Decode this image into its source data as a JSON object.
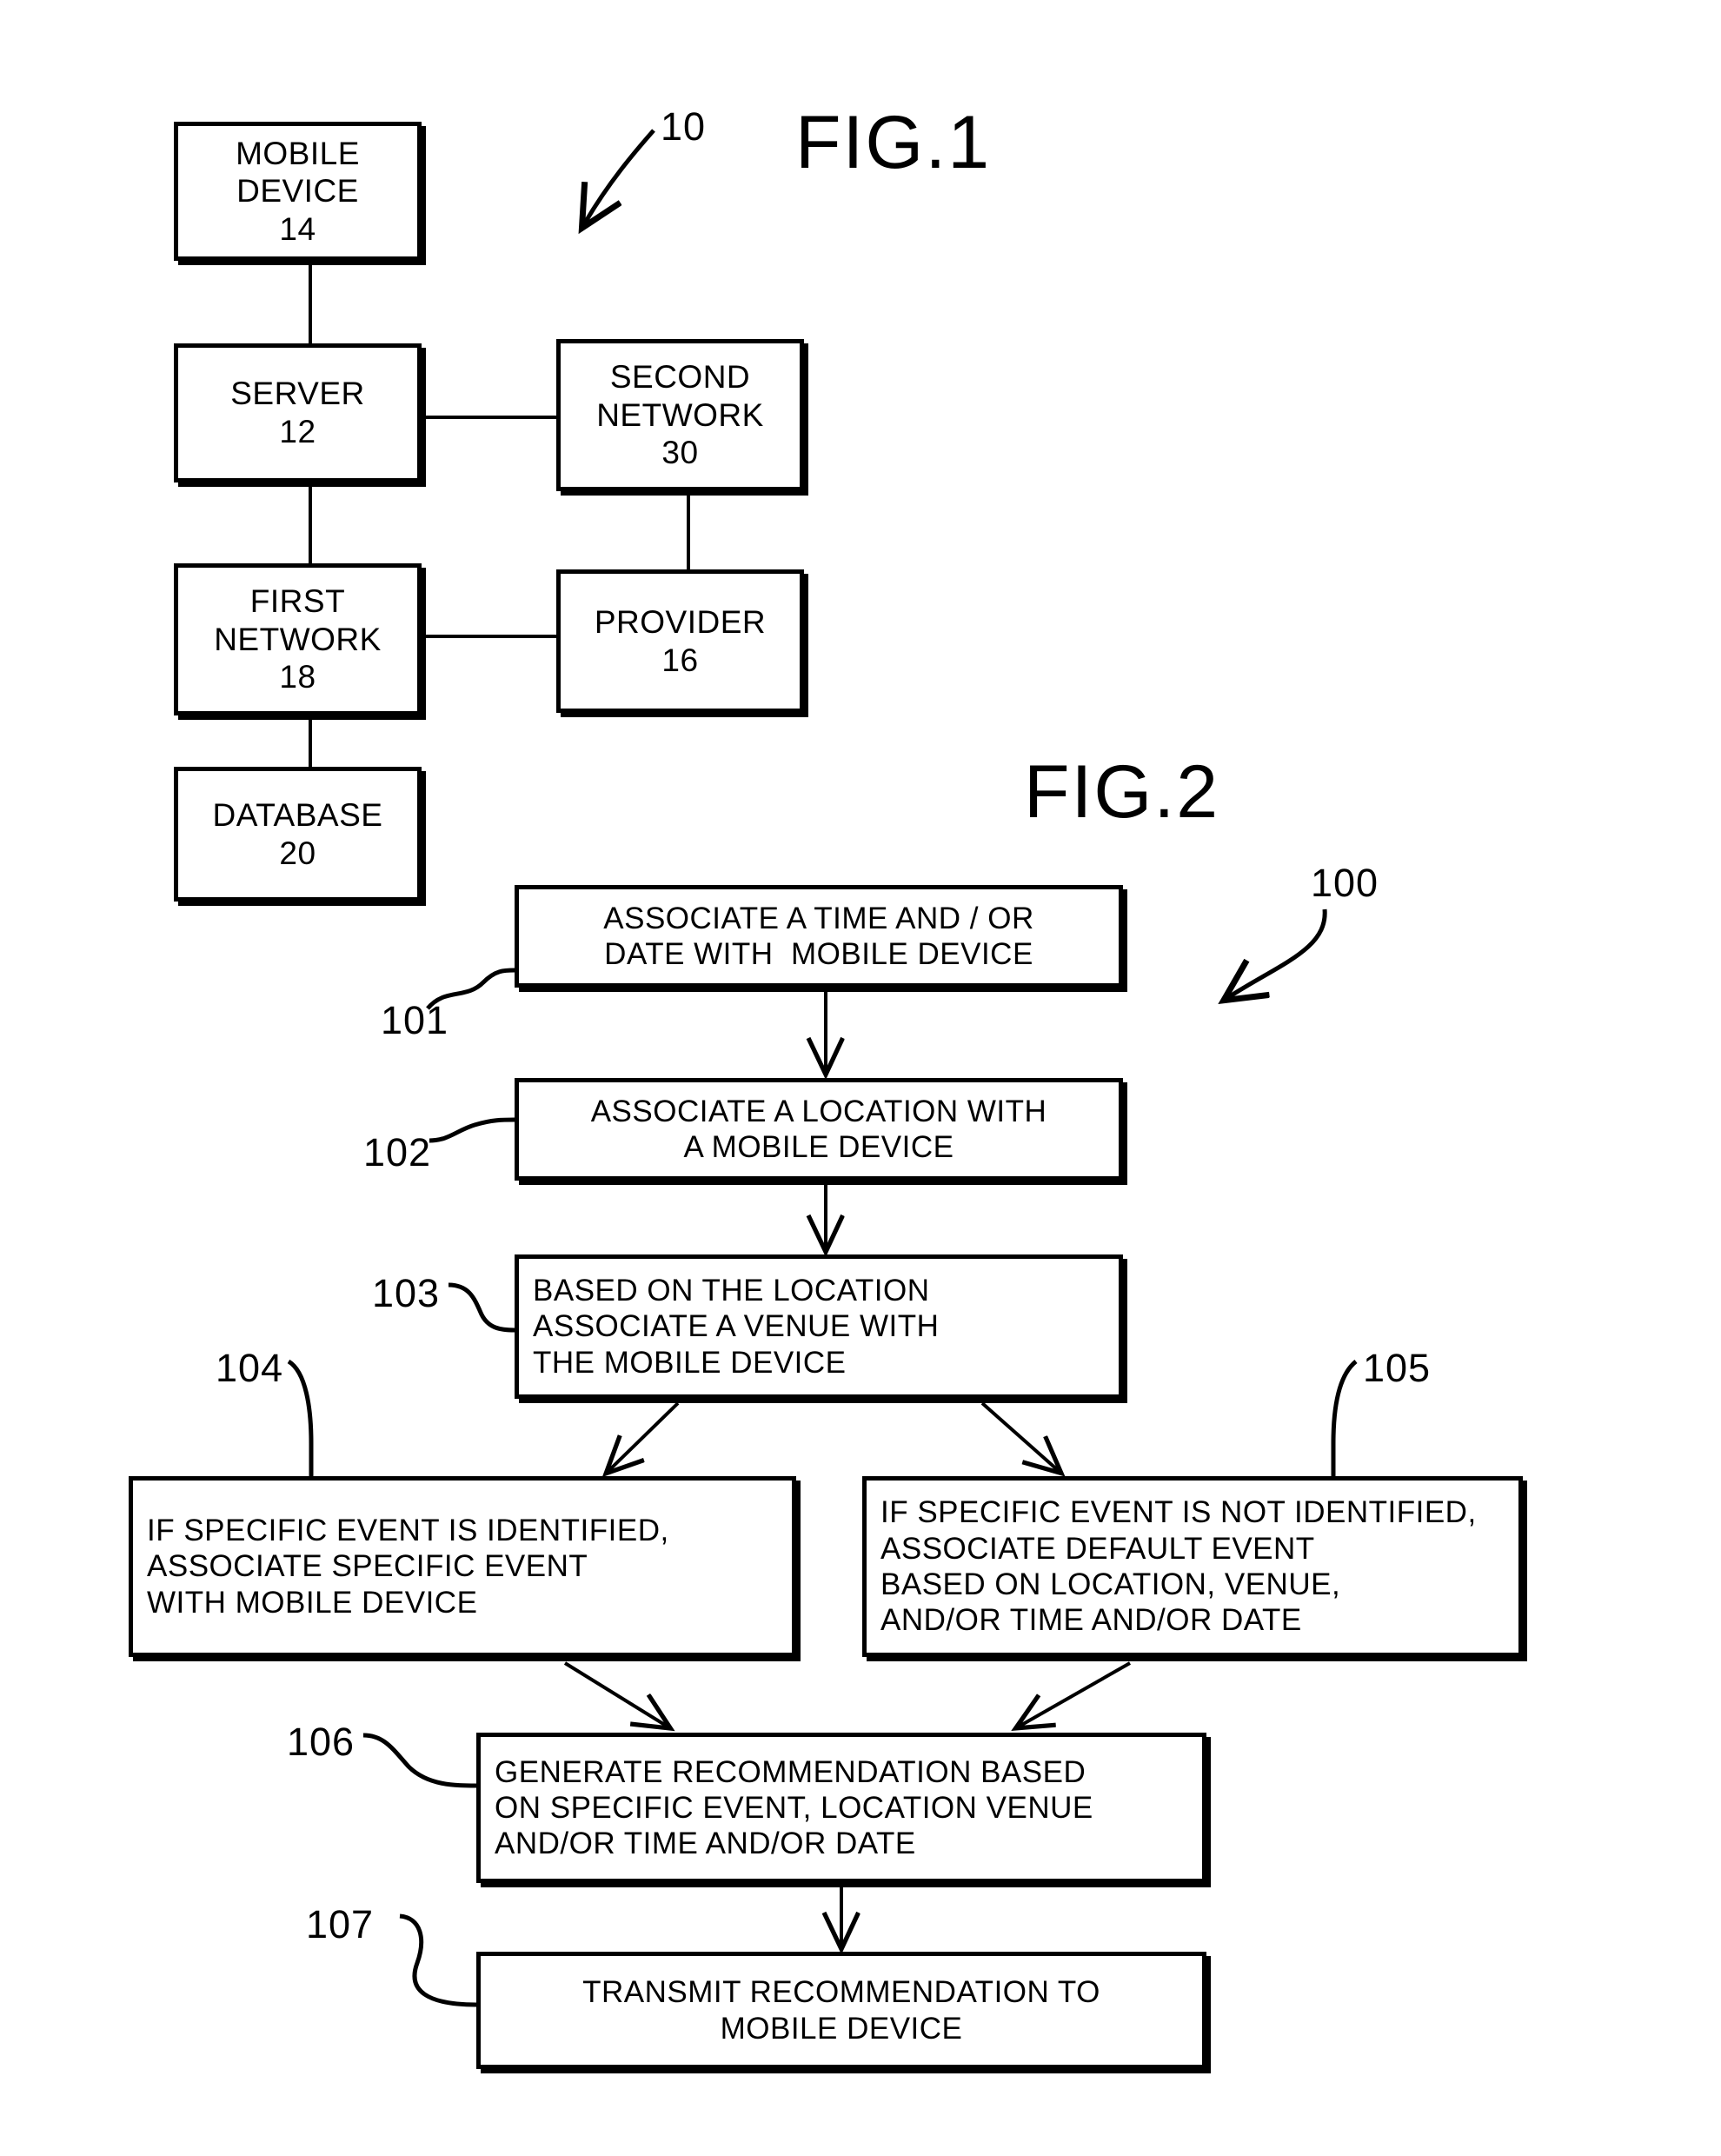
{
  "figures": {
    "fig1": {
      "title": "FIG.1",
      "system_ref": "10",
      "nodes": [
        {
          "id": "mobile_device",
          "lines": [
            "MOBILE",
            "DEVICE",
            "14"
          ],
          "ref": "14",
          "name": "MOBILE DEVICE"
        },
        {
          "id": "server",
          "lines": [
            "SERVER",
            "12"
          ],
          "ref": "12",
          "name": "SERVER"
        },
        {
          "id": "second_network",
          "lines": [
            "SECOND",
            "NETWORK",
            "30"
          ],
          "ref": "30",
          "name": "SECOND NETWORK"
        },
        {
          "id": "first_network",
          "lines": [
            "FIRST",
            "NETWORK",
            "18"
          ],
          "ref": "18",
          "name": "FIRST NETWORK"
        },
        {
          "id": "provider",
          "lines": [
            "PROVIDER",
            "16"
          ],
          "ref": "16",
          "name": "PROVIDER"
        },
        {
          "id": "database",
          "lines": [
            "DATABASE",
            "20"
          ],
          "ref": "20",
          "name": "DATABASE"
        }
      ]
    },
    "fig2": {
      "title": "FIG.2",
      "method_ref": "100",
      "steps": [
        {
          "ref": "101",
          "lines": [
            "ASSOCIATE A TIME AND / OR",
            "DATE WITH  MOBILE DEVICE"
          ]
        },
        {
          "ref": "102",
          "lines": [
            "ASSOCIATE A LOCATION WITH",
            "A MOBILE DEVICE"
          ]
        },
        {
          "ref": "103",
          "lines": [
            "BASED ON THE LOCATION",
            "ASSOCIATE A VENUE WITH",
            "THE MOBILE DEVICE"
          ]
        },
        {
          "ref": "104",
          "lines": [
            "IF SPECIFIC EVENT IS IDENTIFIED,",
            "ASSOCIATE SPECIFIC EVENT",
            "WITH MOBILE DEVICE"
          ]
        },
        {
          "ref": "105",
          "lines": [
            "IF SPECIFIC EVENT IS NOT IDENTIFIED,",
            "ASSOCIATE DEFAULT EVENT",
            "BASED ON LOCATION, VENUE,",
            "AND/OR TIME AND/OR DATE"
          ]
        },
        {
          "ref": "106",
          "lines": [
            "GENERATE RECOMMENDATION BASED",
            "ON SPECIFIC EVENT, LOCATION VENUE",
            "AND/OR TIME AND/OR DATE"
          ]
        },
        {
          "ref": "107",
          "lines": [
            "TRANSMIT RECOMMENDATION TO",
            "MOBILE DEVICE"
          ]
        }
      ]
    }
  },
  "style": {
    "ink": "#000000",
    "paper": "#ffffff"
  }
}
